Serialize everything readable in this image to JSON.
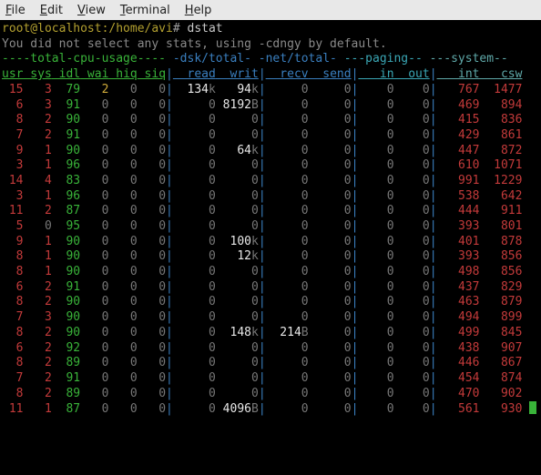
{
  "menu": {
    "items": [
      "File",
      "Edit",
      "View",
      "Terminal",
      "Help"
    ]
  },
  "prompt": {
    "user": "root",
    "host": "localhost",
    "path": "/home/avi",
    "glyph": "#",
    "command": "dstat"
  },
  "messages": {
    "line1": "You did not select any stats, using -cdngy by default."
  },
  "group_header": "----total-cpu-usage---- -dsk/total- -net/total- ---paging-- ---system--",
  "groups": [
    {
      "label": "----total-cpu-usage----",
      "class": "c-green"
    },
    {
      "label": " ",
      "class": ""
    },
    {
      "label": "-dsk/total-",
      "class": "c-blue"
    },
    {
      "label": " ",
      "class": ""
    },
    {
      "label": "-net/total-",
      "class": "c-blue"
    },
    {
      "label": " ",
      "class": ""
    },
    {
      "label": "---paging--",
      "class": "c-cyan"
    },
    {
      "label": " ",
      "class": ""
    },
    {
      "label": "---system--",
      "class": "c-csw"
    }
  ],
  "columns": [
    {
      "name": "usr",
      "class": "c-green",
      "w": 3
    },
    {
      "name": "sys",
      "class": "c-green",
      "w": 4
    },
    {
      "name": "idl",
      "class": "c-green",
      "w": 4
    },
    {
      "name": "wai",
      "class": "c-green",
      "w": 4
    },
    {
      "name": "hiq",
      "class": "c-green",
      "w": 4
    },
    {
      "name": "siq",
      "class": "c-green",
      "w": 4
    },
    {
      "name": "read",
      "class": "c-blue",
      "w": 6
    },
    {
      "name": "writ",
      "class": "c-blue",
      "w": 6
    },
    {
      "name": "recv",
      "class": "c-blue",
      "w": 6
    },
    {
      "name": "send",
      "class": "c-blue",
      "w": 6
    },
    {
      "name": "in",
      "class": "c-cyan",
      "w": 5
    },
    {
      "name": "out",
      "class": "c-cyan",
      "w": 5
    },
    {
      "name": "int",
      "class": "c-csw",
      "w": 6
    },
    {
      "name": "csw",
      "class": "c-csw",
      "w": 6
    }
  ],
  "rows": [
    {
      "usr": 15,
      "sys": 3,
      "idl": 79,
      "wai": 2,
      "hiq": 0,
      "siq": 0,
      "read": "134k",
      "writ": "94k",
      "recv": 0,
      "send": 0,
      "in": 0,
      "out": 0,
      "int": 767,
      "csw": 1477
    },
    {
      "usr": 6,
      "sys": 3,
      "idl": 91,
      "wai": 0,
      "hiq": 0,
      "siq": 0,
      "read": 0,
      "writ": "8192B",
      "recv": 0,
      "send": 0,
      "in": 0,
      "out": 0,
      "int": 469,
      "csw": 894
    },
    {
      "usr": 8,
      "sys": 2,
      "idl": 90,
      "wai": 0,
      "hiq": 0,
      "siq": 0,
      "read": 0,
      "writ": 0,
      "recv": 0,
      "send": 0,
      "in": 0,
      "out": 0,
      "int": 415,
      "csw": 836
    },
    {
      "usr": 7,
      "sys": 2,
      "idl": 91,
      "wai": 0,
      "hiq": 0,
      "siq": 0,
      "read": 0,
      "writ": 0,
      "recv": 0,
      "send": 0,
      "in": 0,
      "out": 0,
      "int": 429,
      "csw": 861
    },
    {
      "usr": 9,
      "sys": 1,
      "idl": 90,
      "wai": 0,
      "hiq": 0,
      "siq": 0,
      "read": 0,
      "writ": "64k",
      "recv": 0,
      "send": 0,
      "in": 0,
      "out": 0,
      "int": 447,
      "csw": 872
    },
    {
      "usr": 3,
      "sys": 1,
      "idl": 96,
      "wai": 0,
      "hiq": 0,
      "siq": 0,
      "read": 0,
      "writ": 0,
      "recv": 0,
      "send": 0,
      "in": 0,
      "out": 0,
      "int": 610,
      "csw": 1071
    },
    {
      "usr": 14,
      "sys": 4,
      "idl": 83,
      "wai": 0,
      "hiq": 0,
      "siq": 0,
      "read": 0,
      "writ": 0,
      "recv": 0,
      "send": 0,
      "in": 0,
      "out": 0,
      "int": 991,
      "csw": 1229
    },
    {
      "usr": 3,
      "sys": 1,
      "idl": 96,
      "wai": 0,
      "hiq": 0,
      "siq": 0,
      "read": 0,
      "writ": 0,
      "recv": 0,
      "send": 0,
      "in": 0,
      "out": 0,
      "int": 538,
      "csw": 642
    },
    {
      "usr": 11,
      "sys": 2,
      "idl": 87,
      "wai": 0,
      "hiq": 0,
      "siq": 0,
      "read": 0,
      "writ": 0,
      "recv": 0,
      "send": 0,
      "in": 0,
      "out": 0,
      "int": 444,
      "csw": 911
    },
    {
      "usr": 5,
      "sys": 0,
      "idl": 95,
      "wai": 0,
      "hiq": 0,
      "siq": 0,
      "read": 0,
      "writ": 0,
      "recv": 0,
      "send": 0,
      "in": 0,
      "out": 0,
      "int": 393,
      "csw": 801
    },
    {
      "usr": 9,
      "sys": 1,
      "idl": 90,
      "wai": 0,
      "hiq": 0,
      "siq": 0,
      "read": 0,
      "writ": "100k",
      "recv": 0,
      "send": 0,
      "in": 0,
      "out": 0,
      "int": 401,
      "csw": 878
    },
    {
      "usr": 8,
      "sys": 1,
      "idl": 90,
      "wai": 0,
      "hiq": 0,
      "siq": 0,
      "read": 0,
      "writ": "12k",
      "recv": 0,
      "send": 0,
      "in": 0,
      "out": 0,
      "int": 393,
      "csw": 856
    },
    {
      "usr": 8,
      "sys": 1,
      "idl": 90,
      "wai": 0,
      "hiq": 0,
      "siq": 0,
      "read": 0,
      "writ": 0,
      "recv": 0,
      "send": 0,
      "in": 0,
      "out": 0,
      "int": 498,
      "csw": 856
    },
    {
      "usr": 6,
      "sys": 2,
      "idl": 91,
      "wai": 0,
      "hiq": 0,
      "siq": 0,
      "read": 0,
      "writ": 0,
      "recv": 0,
      "send": 0,
      "in": 0,
      "out": 0,
      "int": 437,
      "csw": 829
    },
    {
      "usr": 8,
      "sys": 2,
      "idl": 90,
      "wai": 0,
      "hiq": 0,
      "siq": 0,
      "read": 0,
      "writ": 0,
      "recv": 0,
      "send": 0,
      "in": 0,
      "out": 0,
      "int": 463,
      "csw": 879
    },
    {
      "usr": 7,
      "sys": 3,
      "idl": 90,
      "wai": 0,
      "hiq": 0,
      "siq": 0,
      "read": 0,
      "writ": 0,
      "recv": 0,
      "send": 0,
      "in": 0,
      "out": 0,
      "int": 494,
      "csw": 899
    },
    {
      "usr": 8,
      "sys": 2,
      "idl": 90,
      "wai": 0,
      "hiq": 0,
      "siq": 0,
      "read": 0,
      "writ": "148k",
      "recv": "214B",
      "send": 0,
      "in": 0,
      "out": 0,
      "int": 499,
      "csw": 845
    },
    {
      "usr": 6,
      "sys": 2,
      "idl": 92,
      "wai": 0,
      "hiq": 0,
      "siq": 0,
      "read": 0,
      "writ": 0,
      "recv": 0,
      "send": 0,
      "in": 0,
      "out": 0,
      "int": 438,
      "csw": 907
    },
    {
      "usr": 8,
      "sys": 2,
      "idl": 89,
      "wai": 0,
      "hiq": 0,
      "siq": 0,
      "read": 0,
      "writ": 0,
      "recv": 0,
      "send": 0,
      "in": 0,
      "out": 0,
      "int": 446,
      "csw": 867
    },
    {
      "usr": 7,
      "sys": 2,
      "idl": 91,
      "wai": 0,
      "hiq": 0,
      "siq": 0,
      "read": 0,
      "writ": 0,
      "recv": 0,
      "send": 0,
      "in": 0,
      "out": 0,
      "int": 454,
      "csw": 874
    },
    {
      "usr": 8,
      "sys": 2,
      "idl": 89,
      "wai": 0,
      "hiq": 0,
      "siq": 0,
      "read": 0,
      "writ": 0,
      "recv": 0,
      "send": 0,
      "in": 0,
      "out": 0,
      "int": 470,
      "csw": 902
    },
    {
      "usr": 11,
      "sys": 1,
      "idl": 87,
      "wai": 0,
      "hiq": 0,
      "siq": 0,
      "read": 0,
      "writ": "4096B",
      "recv": 0,
      "send": 0,
      "in": 0,
      "out": 0,
      "int": 561,
      "csw": 930,
      "cursor": true
    }
  ]
}
